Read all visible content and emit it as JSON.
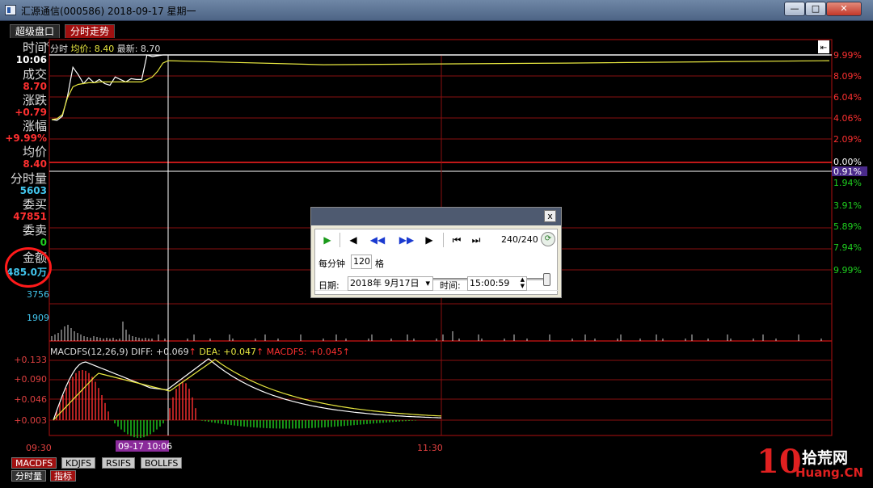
{
  "window": {
    "title": "汇源通信(000586) 2018-09-17 星期一",
    "min_label": "—",
    "max_label": "□",
    "close_label": "✕"
  },
  "top_tabs": [
    {
      "label": "超级盘口"
    },
    {
      "label": "分时走势"
    }
  ],
  "side_panel": {
    "time_label": "时间",
    "time_value": "10:06",
    "deal_label": "成交",
    "deal_value": "8.70",
    "change_label": "涨跌",
    "change_value": "+0.79",
    "pct_label": "涨幅",
    "pct_value": "+9.99%",
    "avg_label": "均价",
    "avg_value": "8.40",
    "vol_label": "分时量",
    "vol_value": "5603",
    "buy_label": "委买",
    "buy_value": "47851",
    "sell_label": "委卖",
    "sell_value": "0",
    "amount_label": "金额",
    "amount_value": "485.0万"
  },
  "price_header": {
    "prefix": "分时",
    "avg": "均价: 8.40",
    "last": "最新: 8.70"
  },
  "right_ticks": [
    {
      "label": "9.99%",
      "color": "#ff3030"
    },
    {
      "label": "8.09%",
      "color": "#ff3030"
    },
    {
      "label": "6.04%",
      "color": "#ff3030"
    },
    {
      "label": "4.06%",
      "color": "#ff3030"
    },
    {
      "label": "2.09%",
      "color": "#ff3030"
    },
    {
      "label": "0.00%",
      "color": "#ffffff"
    },
    {
      "label": "0.91%",
      "color": "#ffffff"
    },
    {
      "label": "1.94%",
      "color": "#1fd01f"
    },
    {
      "label": "3.91%",
      "color": "#1fd01f"
    },
    {
      "label": "5.89%",
      "color": "#1fd01f"
    },
    {
      "label": "7.94%",
      "color": "#1fd01f"
    },
    {
      "label": "9.99%",
      "color": "#1fd01f"
    }
  ],
  "volume_ticks": [
    "3756",
    "1909"
  ],
  "macd_header": {
    "name": "MACDFS(12,26,9)",
    "diff": "DIFF: +0.069",
    "dea": "DEA: +0.047",
    "macd": "MACDFS: +0.045"
  },
  "macd_ticks": [
    "+0.133",
    "+0.090",
    "+0.046",
    "+0.003"
  ],
  "time_axis": {
    "start": "09:30",
    "cursor": "09-17 10:06",
    "mid": "11:30"
  },
  "playback": {
    "close_label": "x",
    "play_icon": "play-icon",
    "counter": "240/240",
    "per_min_label": "每分钟",
    "per_min_value": "120",
    "per_min_unit": "格",
    "date_label": "日期:",
    "date_value": "2018年 9月17日",
    "time_label": "时间:",
    "time_value": "15:00:59"
  },
  "bottom_tabs": [
    "MACDFS",
    "KDJFS",
    "RSIFS",
    "BOLLFS"
  ],
  "bottom_tabs2": [
    "分时量",
    "指标"
  ],
  "watermark": {
    "ten": "10",
    "cn": "拾荒网",
    "en": "Huang.CN"
  },
  "chart_data": {
    "type": "line",
    "series": [
      {
        "values": [
          7.91,
          7.9,
          7.95,
          8.2,
          8.55,
          8.46,
          8.35,
          8.42,
          8.36,
          8.4,
          8.35,
          8.33,
          8.43,
          8.4,
          8.37,
          8.41,
          8.4,
          8.4,
          8.7,
          8.68,
          8.69,
          8.7,
          8.7
        ]
      },
      {
        "values": [
          7.91,
          7.92,
          7.97,
          8.18,
          8.31,
          8.34,
          8.35,
          8.36,
          8.36,
          8.37,
          8.37,
          8.37,
          8.37,
          8.37,
          8.37,
          8.37,
          8.37,
          8.37,
          8.4,
          8.43,
          8.5,
          8.6,
          8.63
        ]
      }
    ],
    "ylim": [
      7.12,
      8.7
    ]
  }
}
